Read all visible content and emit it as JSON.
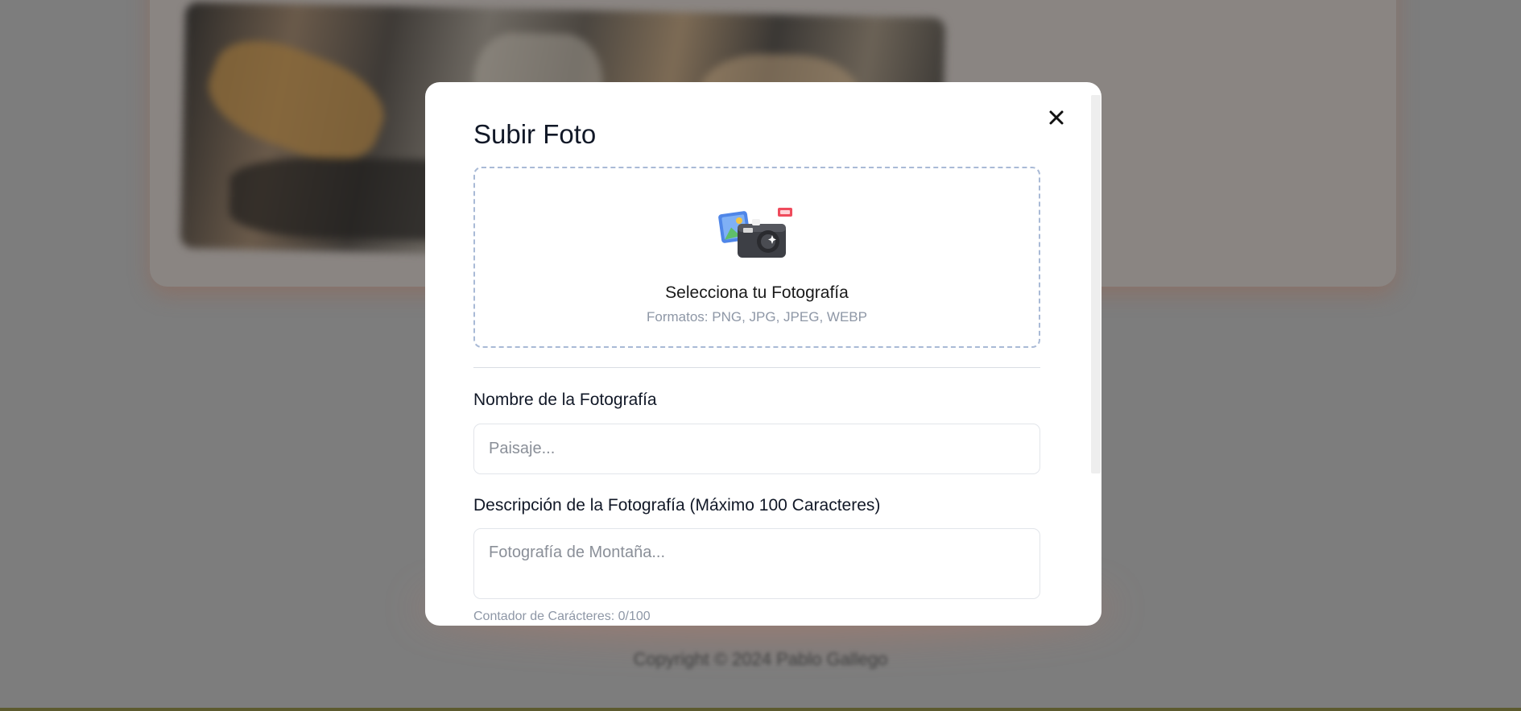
{
  "modal": {
    "title": "Subir Foto",
    "dropzone": {
      "title": "Selecciona tu Fotografía",
      "formats": "Formatos: PNG, JPG, JPEG, WEBP"
    },
    "name_field": {
      "label": "Nombre de la Fotografía",
      "placeholder": "Paisaje...",
      "value": ""
    },
    "description_field": {
      "label": "Descripción de la Fotografía (Máximo 100 Caracteres)",
      "placeholder": "Fotografía de Montaña...",
      "value": ""
    },
    "counter": "Contador de Carácteres: 0/100"
  },
  "background": {
    "copyright": "Copyright © 2024 Pablo Gallego"
  },
  "icons": {
    "close": "close-icon",
    "upload": "camera-photo-icon"
  },
  "colors": {
    "overlay": "#7d7d7d",
    "dropzone_border": "#a9bad6",
    "muted_text": "#8e97a6"
  }
}
